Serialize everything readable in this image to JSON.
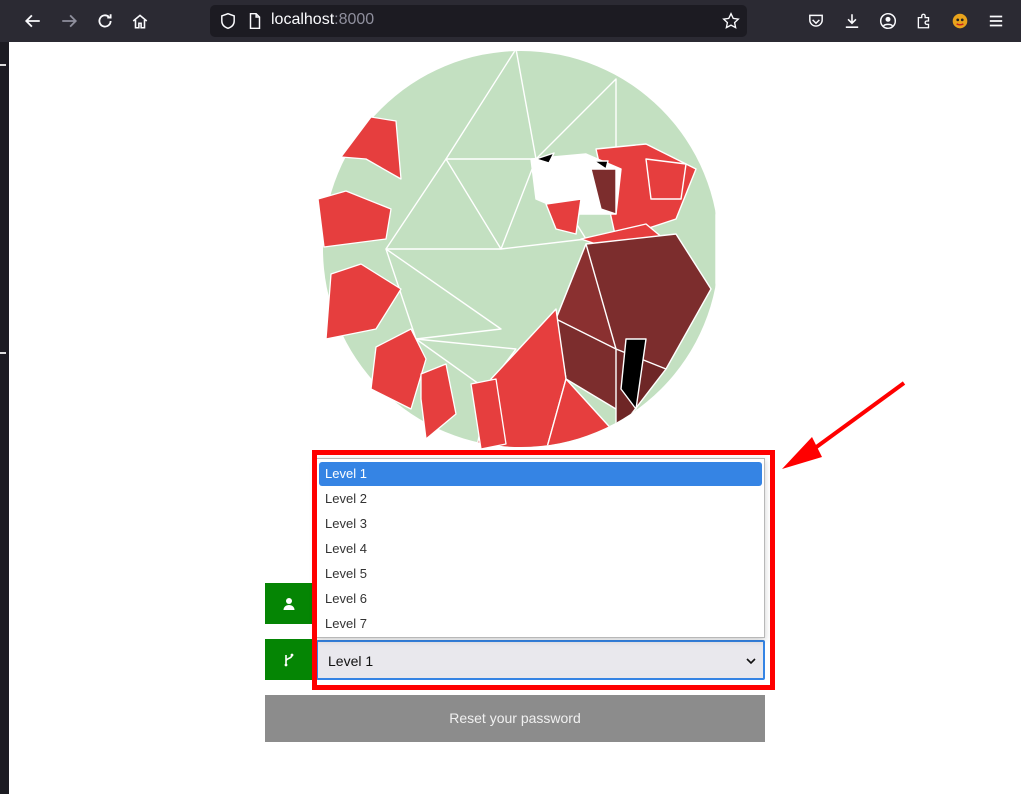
{
  "browser": {
    "url_host": "localhost",
    "url_port": ":8000"
  },
  "form": {
    "level_select": {
      "selected_value": "Level 1",
      "options": [
        "Level 1",
        "Level 2",
        "Level 3",
        "Level 4",
        "Level 5",
        "Level 6",
        "Level 7"
      ]
    },
    "reset_button_label": "Reset your password"
  },
  "colors": {
    "addon_green": "#058504",
    "highlight_red": "#ff0000",
    "selected_blue": "#3584e4",
    "button_gray": "#8c8c8c"
  },
  "icons": {
    "back": "back-arrow-icon",
    "forward": "forward-arrow-icon",
    "reload": "reload-icon",
    "home": "home-icon",
    "shield": "shield-icon",
    "page": "page-icon",
    "bookmark": "star-icon",
    "pocket": "pocket-icon",
    "downloads": "download-icon",
    "account": "account-icon",
    "extensions": "extensions-icon",
    "menu": "hamburger-menu-icon",
    "user_addon": "user-icon",
    "branch_addon": "branch-icon"
  }
}
